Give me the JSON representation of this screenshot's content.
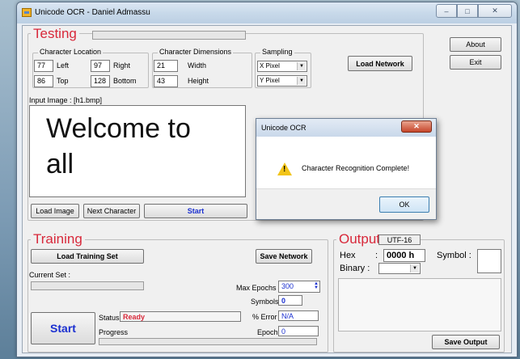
{
  "window": {
    "title": "Unicode OCR - Daniel Admassu",
    "min": "–",
    "max": "□",
    "close": "✕"
  },
  "testing": {
    "title": "Testing",
    "char_location": {
      "legend": "Character Location",
      "left_val": "77",
      "left_label": "Left",
      "right_val": "97",
      "right_label": "Right",
      "top_val": "86",
      "top_label": "Top",
      "bottom_val": "128",
      "bottom_label": "Bottom"
    },
    "char_dims": {
      "legend": "Character Dimensions",
      "width_val": "21",
      "width_label": "Width",
      "height_val": "43",
      "height_label": "Height"
    },
    "sampling": {
      "legend": "Sampling",
      "x": "X  Pixel",
      "y": "Y  Pixel"
    },
    "load_network": "Load Network",
    "input_image_label": "Input Image : [h1.bmp]",
    "image_text_line1": "Welcome to",
    "image_text_line2": "all",
    "load_image": "Load Image",
    "next_character": "Next Character",
    "start": "Start",
    "axis_min": "0",
    "axis_max": "19"
  },
  "side": {
    "about": "About",
    "exit": "Exit"
  },
  "dialog": {
    "title": "Unicode OCR",
    "close": "✕",
    "message": "Character Recognition Complete!",
    "ok": "OK",
    "icon": "!"
  },
  "training": {
    "title": "Training",
    "load_set": "Load Training Set",
    "save_network": "Save Network",
    "current_set": "Current Set :",
    "max_epochs_label": "Max Epochs",
    "max_epochs_val": "300",
    "symbols_label": "Symbols",
    "symbols_val": "0",
    "status_label": "Status :",
    "status_val": "Ready",
    "error_label": "% Error",
    "error_val": "N/A",
    "progress_label": "Progress",
    "epoch_label": "Epoch :",
    "epoch_val": "0",
    "start": "Start"
  },
  "output": {
    "title": "Output",
    "encoding": "UTF-16",
    "hex_label": "Hex",
    "hex_sep": ":",
    "hex_val": "0000 h",
    "symbol_label": "Symbol :",
    "binary_label": "Binary :",
    "save_output": "Save Output"
  }
}
